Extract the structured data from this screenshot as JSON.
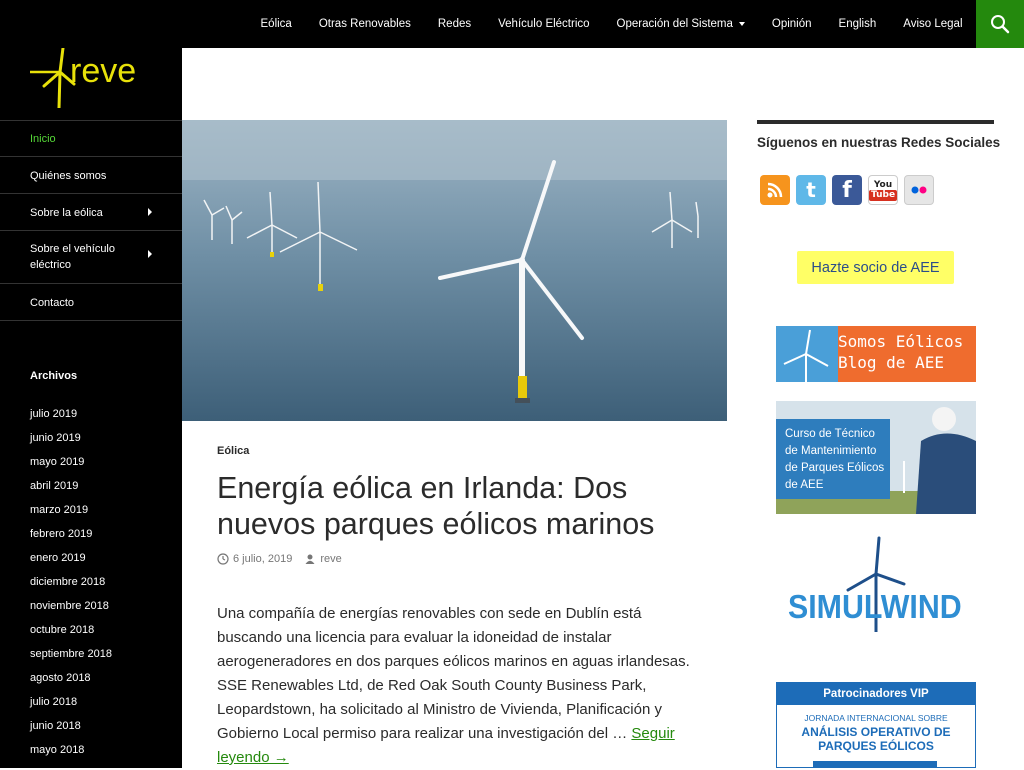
{
  "top_nav": {
    "items": [
      {
        "label": "Eólica"
      },
      {
        "label": "Otras Renovables"
      },
      {
        "label": "Redes"
      },
      {
        "label": "Vehículo Eléctrico"
      },
      {
        "label": "Operación del Sistema",
        "has_dropdown": true
      },
      {
        "label": "Opinión"
      },
      {
        "label": "English"
      },
      {
        "label": "Aviso Legal"
      }
    ],
    "search_icon": "search-icon",
    "search_bg": "#24890d"
  },
  "site": {
    "logo_text": "reve",
    "logo_color": "#e8e10a"
  },
  "sidebar": {
    "menu": [
      {
        "label": "Inicio",
        "active": true
      },
      {
        "label": "Quiénes somos"
      },
      {
        "label": "Sobre la eólica",
        "has_submenu": true
      },
      {
        "label": "Sobre el vehículo eléctrico",
        "has_submenu": true
      },
      {
        "label": "Contacto"
      }
    ],
    "archives_title": "Archivos",
    "archives": [
      "julio 2019",
      "junio 2019",
      "mayo 2019",
      "abril 2019",
      "marzo 2019",
      "febrero 2019",
      "enero 2019",
      "diciembre 2018",
      "noviembre 2018",
      "octubre 2018",
      "septiembre 2018",
      "agosto 2018",
      "julio 2018",
      "junio 2018",
      "mayo 2018"
    ]
  },
  "post": {
    "category": "Eólica",
    "title": "Energía eólica en Irlanda: Dos nuevos parques eólicos marinos",
    "date": "6 julio, 2019",
    "author": "reve",
    "excerpt": "Una compañía de energías renovables con sede en Dublín está buscando una licencia para evaluar la idoneidad de instalar aerogeneradores en dos parques eólicos marinos en aguas irlandesas. SSE Renewables Ltd, de Red Oak South County Business Park, Leopardstown, ha solicitado al Ministro de Vivienda, Planificación y Gobierno Local permiso para realizar una investigación del …",
    "read_more": "Seguir leyendo →"
  },
  "right_sidebar": {
    "social_title": "Síguenos en nuestras Redes Sociales",
    "social_icons": [
      {
        "name": "rss-icon",
        "glyph": "◉",
        "color": "#f6941d"
      },
      {
        "name": "twitter-icon",
        "glyph": "t",
        "color": "#5fb8e8"
      },
      {
        "name": "facebook-icon",
        "glyph": "f",
        "color": "#3b5998"
      },
      {
        "name": "youtube-icon",
        "glyph": "You Tube",
        "color": "#d7301f"
      },
      {
        "name": "flickr-icon",
        "glyph": "●●",
        "color": "#e6e6e6"
      }
    ],
    "join_label": "Hazte socio de AEE",
    "blog_banner": "Somos Eólicos\nBlog de AEE",
    "course_banner": "Curso de Técnico de Mantenimiento de Parques Eólicos de AEE",
    "simulwind": "SIMULWIND",
    "vip_title": "Patrocinadores VIP",
    "vip_line1": "JORNADA INTERNACIONAL SOBRE",
    "vip_line2": "ANÁLISIS OPERATIVO DE PARQUES EÓLICOS"
  }
}
